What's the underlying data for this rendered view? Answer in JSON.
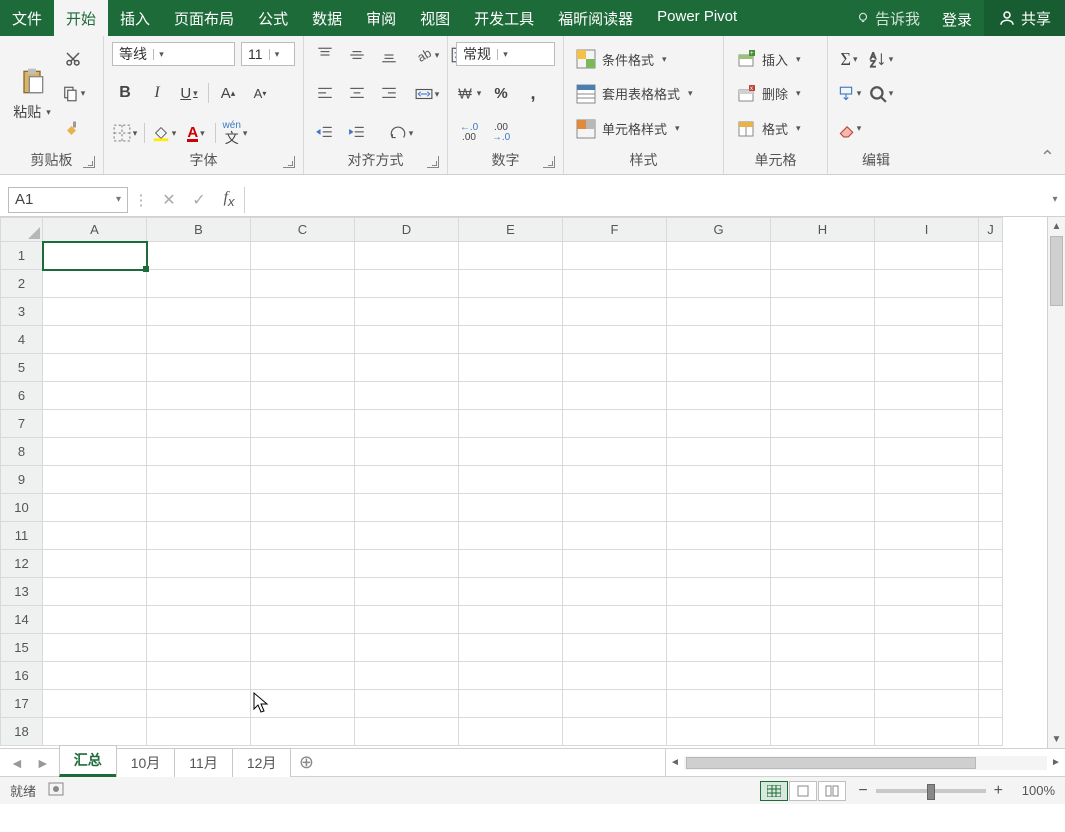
{
  "tabs": {
    "file": "文件",
    "home": "开始",
    "insert": "插入",
    "page_layout": "页面布局",
    "formulas": "公式",
    "data": "数据",
    "review": "审阅",
    "view": "视图",
    "developer": "开发工具",
    "foxit": "福昕阅读器",
    "powerpivot": "Power Pivot",
    "tell_me": "告诉我",
    "login": "登录",
    "share": "共享"
  },
  "ribbon": {
    "clipboard": {
      "label": "剪贴板",
      "paste": "粘贴"
    },
    "font": {
      "label": "字体",
      "name": "等线",
      "size": "11",
      "phonetic": "wén"
    },
    "alignment": {
      "label": "对齐方式"
    },
    "number": {
      "label": "数字",
      "format": "常规",
      "inc": ".0",
      "inc2": ".00",
      "dec": ".00",
      "dec2": ".0"
    },
    "styles": {
      "label": "样式",
      "conditional": "条件格式",
      "table": "套用表格格式",
      "cell": "单元格样式"
    },
    "cells": {
      "label": "单元格",
      "insert": "插入",
      "delete": "删除",
      "format": "格式"
    },
    "editing": {
      "label": "编辑"
    }
  },
  "formula_bar": {
    "name_box": "A1"
  },
  "grid": {
    "columns": [
      "A",
      "B",
      "C",
      "D",
      "E",
      "F",
      "G",
      "H",
      "I",
      "J"
    ],
    "row_count": 18,
    "selected_cell": "A1"
  },
  "sheet_tabs": {
    "active": "汇总",
    "tabs": [
      "汇总",
      "10月",
      "11月",
      "12月"
    ]
  },
  "status_bar": {
    "ready": "就绪",
    "zoom": "100%"
  }
}
